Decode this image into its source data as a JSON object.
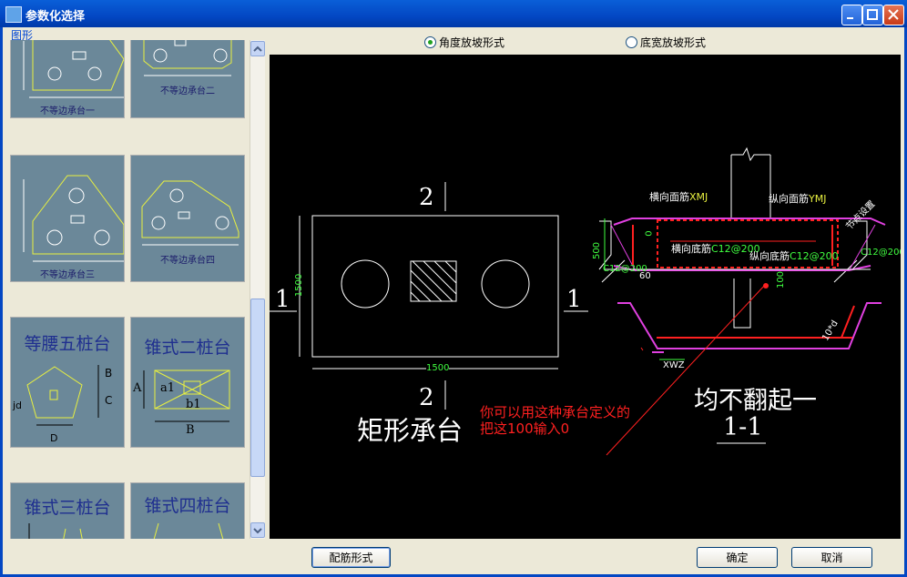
{
  "window": {
    "title": "参数化选择"
  },
  "group": {
    "label": "图形"
  },
  "shapes": [
    {
      "label": "不等边承台一"
    },
    {
      "label": "不等边承台二"
    },
    {
      "label": "不等边承台三"
    },
    {
      "label": "不等边承台四"
    },
    {
      "label": "等腰五桩台"
    },
    {
      "label": "锥式二桩台"
    },
    {
      "label": "锥式三桩台"
    },
    {
      "label": "锥式四桩台"
    }
  ],
  "thumb_text": {
    "B": "B",
    "C": "C",
    "D": "D",
    "jd": "jd",
    "A": "A",
    "a1": "a1",
    "b1": "b1"
  },
  "slope_options": [
    {
      "label": "角度放坡形式",
      "selected": true
    },
    {
      "label": "底宽放坡形式",
      "selected": false
    }
  ],
  "drawing": {
    "plan_title": "矩形承台",
    "section_mark": "2",
    "side_mark": "1",
    "dim_height": "1500",
    "dim_width": "1500",
    "note_line1": "你可以用这种承台定义的",
    "note_line2": "把这100输入0",
    "section_title": "均不翻起一",
    "section_name": "1-1",
    "labels": {
      "top_transverse": "横向面筋",
      "top_transverse_code": "XMJ",
      "top_longitudinal": "纵向面筋",
      "top_longitudinal_code": "YMJ",
      "bottom_transverse": "横向底筋",
      "bottom_longitudinal": "纵向底筋",
      "rebar_spec": "C12@200",
      "cover": "节点设置",
      "h500": "500",
      "zero": "0",
      "angle": "60",
      "hundred": "100",
      "ten_d": "10*d",
      "xwz": "XWZ"
    }
  },
  "buttons": {
    "reinforce": "配筋形式",
    "ok": "确定",
    "cancel": "取消"
  },
  "colors": {
    "title_bar": "#0347c3",
    "canvas_bg": "#000000",
    "rebar": "#ff2020",
    "concrete": "#e040e0",
    "dim": "#40ff40",
    "thumb_bg": "#6b8899",
    "thumb_line": "#e8f040"
  }
}
